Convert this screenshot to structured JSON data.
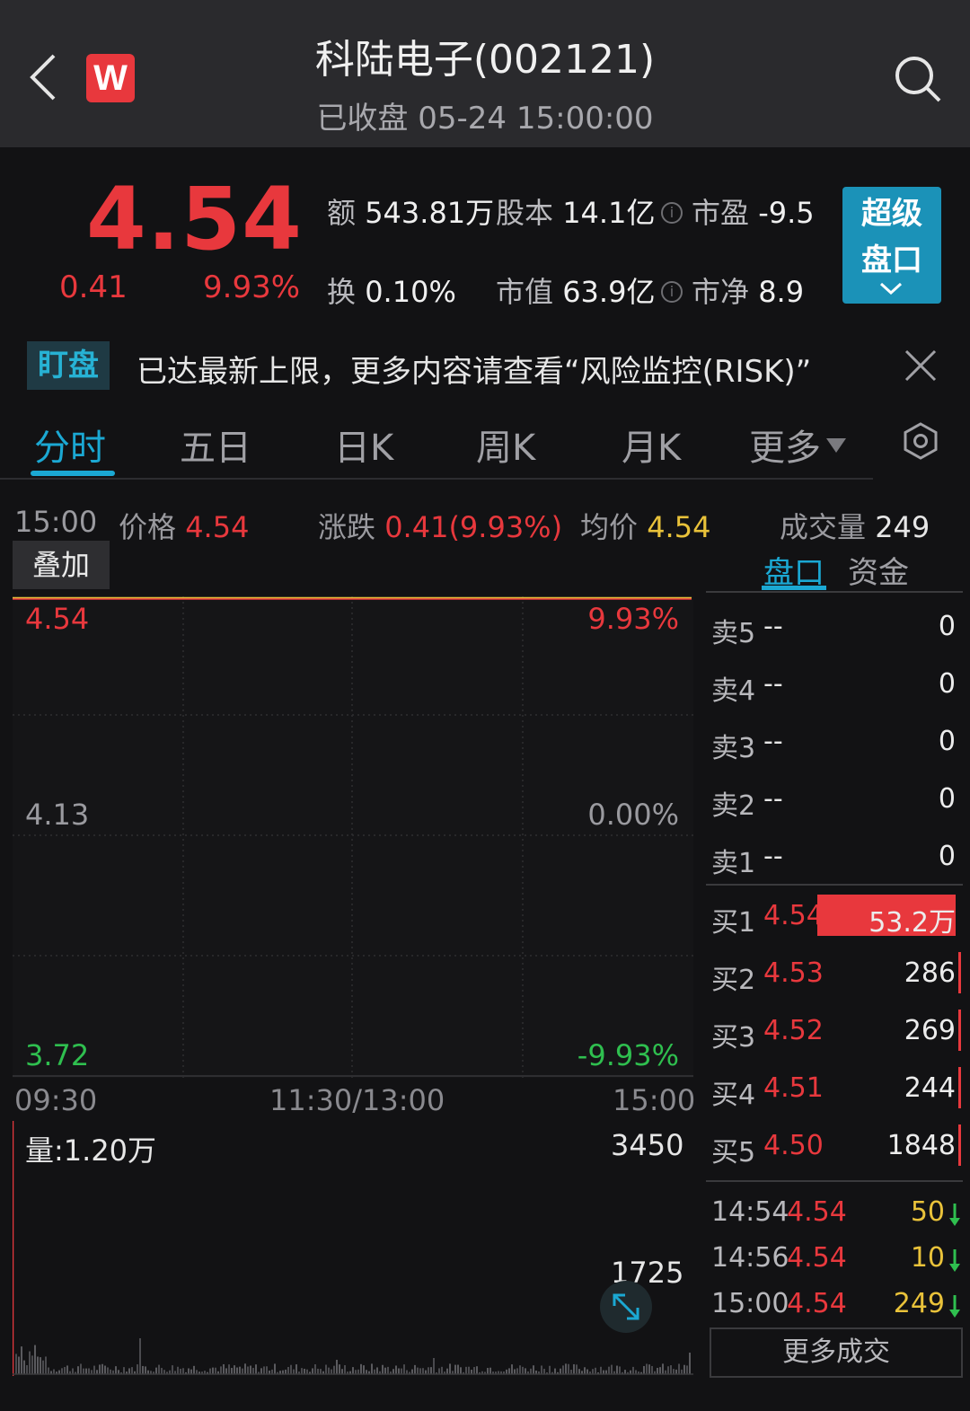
{
  "header": {
    "title": "科陆电子(002121)",
    "subtitle": "已收盘 05-24 15:00:00",
    "logo_letter": "W"
  },
  "quote": {
    "price": "4.54",
    "change": "0.41",
    "change_pct": "9.93%",
    "stats": {
      "amount_label": "额",
      "amount_value": "543.81万",
      "share_capital_label": "股本",
      "share_capital_value": "14.1亿",
      "pe_label": "市盈",
      "pe_value": "-9.5",
      "turnover_label": "换",
      "turnover_value": "0.10%",
      "market_cap_label": "市值",
      "market_cap_value": "63.9亿",
      "pb_label": "市净",
      "pb_value": "8.9"
    },
    "super_button_line1": "超级",
    "super_button_line2": "盘口"
  },
  "banner": {
    "tag": "盯盘",
    "text": "已达最新上限，更多内容请查看“风险监控(RISK)”"
  },
  "tabs": [
    "分时",
    "五日",
    "日K",
    "周K",
    "月K",
    "更多"
  ],
  "active_tab": "分时",
  "info_line": {
    "time": "15:00",
    "price_label": "价格",
    "price_value": "4.54",
    "change_label": "涨跌",
    "change_value": "0.41(9.93%)",
    "avg_label": "均价",
    "avg_value": "4.54",
    "volume_label": "成交量",
    "volume_value": "249"
  },
  "overlay_button": "叠加",
  "subtabs": [
    "盘口",
    "资金"
  ],
  "chart": {
    "price_top": "4.54",
    "price_mid": "4.13",
    "price_bottom": "3.72",
    "pct_top": "9.93%",
    "pct_mid": "0.00%",
    "pct_bottom": "-9.93%",
    "time_start": "09:30",
    "time_mid": "11:30/13:00",
    "time_end": "15:00",
    "volume_label": "量:1.20万",
    "volume_max": "3450",
    "volume_mid": "1725"
  },
  "colors": {
    "up": "#e8383d",
    "down": "#2fbf4f",
    "accent": "#1ba8d3",
    "avg_line": "#e9c23a"
  },
  "order_book": {
    "asks": [
      {
        "label": "卖5",
        "price": "--",
        "qty": "0"
      },
      {
        "label": "卖4",
        "price": "--",
        "qty": "0"
      },
      {
        "label": "卖3",
        "price": "--",
        "qty": "0"
      },
      {
        "label": "卖2",
        "price": "--",
        "qty": "0"
      },
      {
        "label": "卖1",
        "price": "--",
        "qty": "0"
      }
    ],
    "bids": [
      {
        "label": "买1",
        "price": "4.54",
        "qty": "53.2万",
        "fill": 1.0
      },
      {
        "label": "买2",
        "price": "4.53",
        "qty": "286",
        "fill": 0.005
      },
      {
        "label": "买3",
        "price": "4.52",
        "qty": "269",
        "fill": 0.005
      },
      {
        "label": "买4",
        "price": "4.51",
        "qty": "244",
        "fill": 0.005
      },
      {
        "label": "买5",
        "price": "4.50",
        "qty": "1848",
        "fill": 0.005
      }
    ]
  },
  "trades": [
    {
      "time": "14:54",
      "price": "4.54",
      "qty": "50",
      "direction": "down"
    },
    {
      "time": "14:56",
      "price": "4.54",
      "qty": "10",
      "direction": "down"
    },
    {
      "time": "15:00",
      "price": "4.54",
      "qty": "249",
      "direction": "down"
    }
  ],
  "more_trades_label": "更多成交"
}
